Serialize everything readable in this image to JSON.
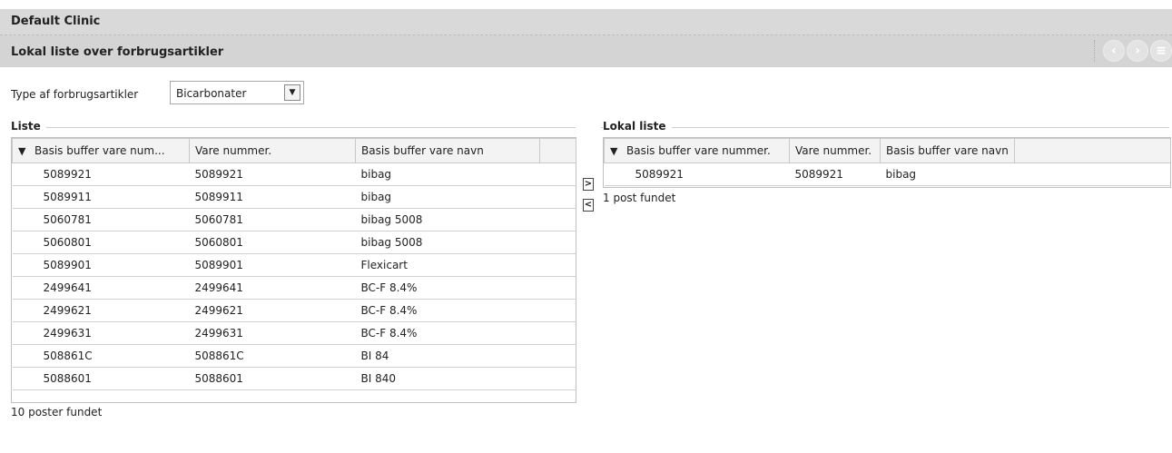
{
  "header": {
    "clinic": "Default Clinic",
    "page_title": "Lokal liste over forbrugsartikler"
  },
  "filter": {
    "label": "Type af forbrugsartikler",
    "selected": "Bicarbonater"
  },
  "left": {
    "section_label": "Liste",
    "columns": [
      "Basis buffer vare num...",
      "Vare nummer.",
      "Basis buffer vare navn"
    ],
    "rows": [
      [
        "5089921",
        "5089921",
        "bibag"
      ],
      [
        "5089911",
        "5089911",
        "bibag"
      ],
      [
        "5060781",
        "5060781",
        "bibag 5008"
      ],
      [
        "5060801",
        "5060801",
        "bibag 5008"
      ],
      [
        "5089901",
        "5089901",
        "Flexicart"
      ],
      [
        "2499641",
        "2499641",
        "BC-F 8.4%"
      ],
      [
        "2499621",
        "2499621",
        "BC-F 8.4%"
      ],
      [
        "2499631",
        "2499631",
        "BC-F 8.4%"
      ],
      [
        "508861C",
        "508861C",
        "BI 84"
      ],
      [
        "5088601",
        "5088601",
        "BI 840"
      ]
    ],
    "found": "10 poster fundet"
  },
  "right": {
    "section_label": "Lokal liste",
    "columns": [
      "Basis buffer vare nummer.",
      "Vare nummer.",
      "Basis buffer vare navn"
    ],
    "rows": [
      [
        "5089921",
        "5089921",
        "bibag"
      ]
    ],
    "found": "1 post fundet"
  },
  "move": {
    "add": ">",
    "remove": "<"
  },
  "icons": {
    "filter": "filter-icon",
    "prev": "chevron-left-icon",
    "next": "chevron-right-icon",
    "menu": "menu-icon",
    "dropdown": "chevron-down-icon"
  }
}
